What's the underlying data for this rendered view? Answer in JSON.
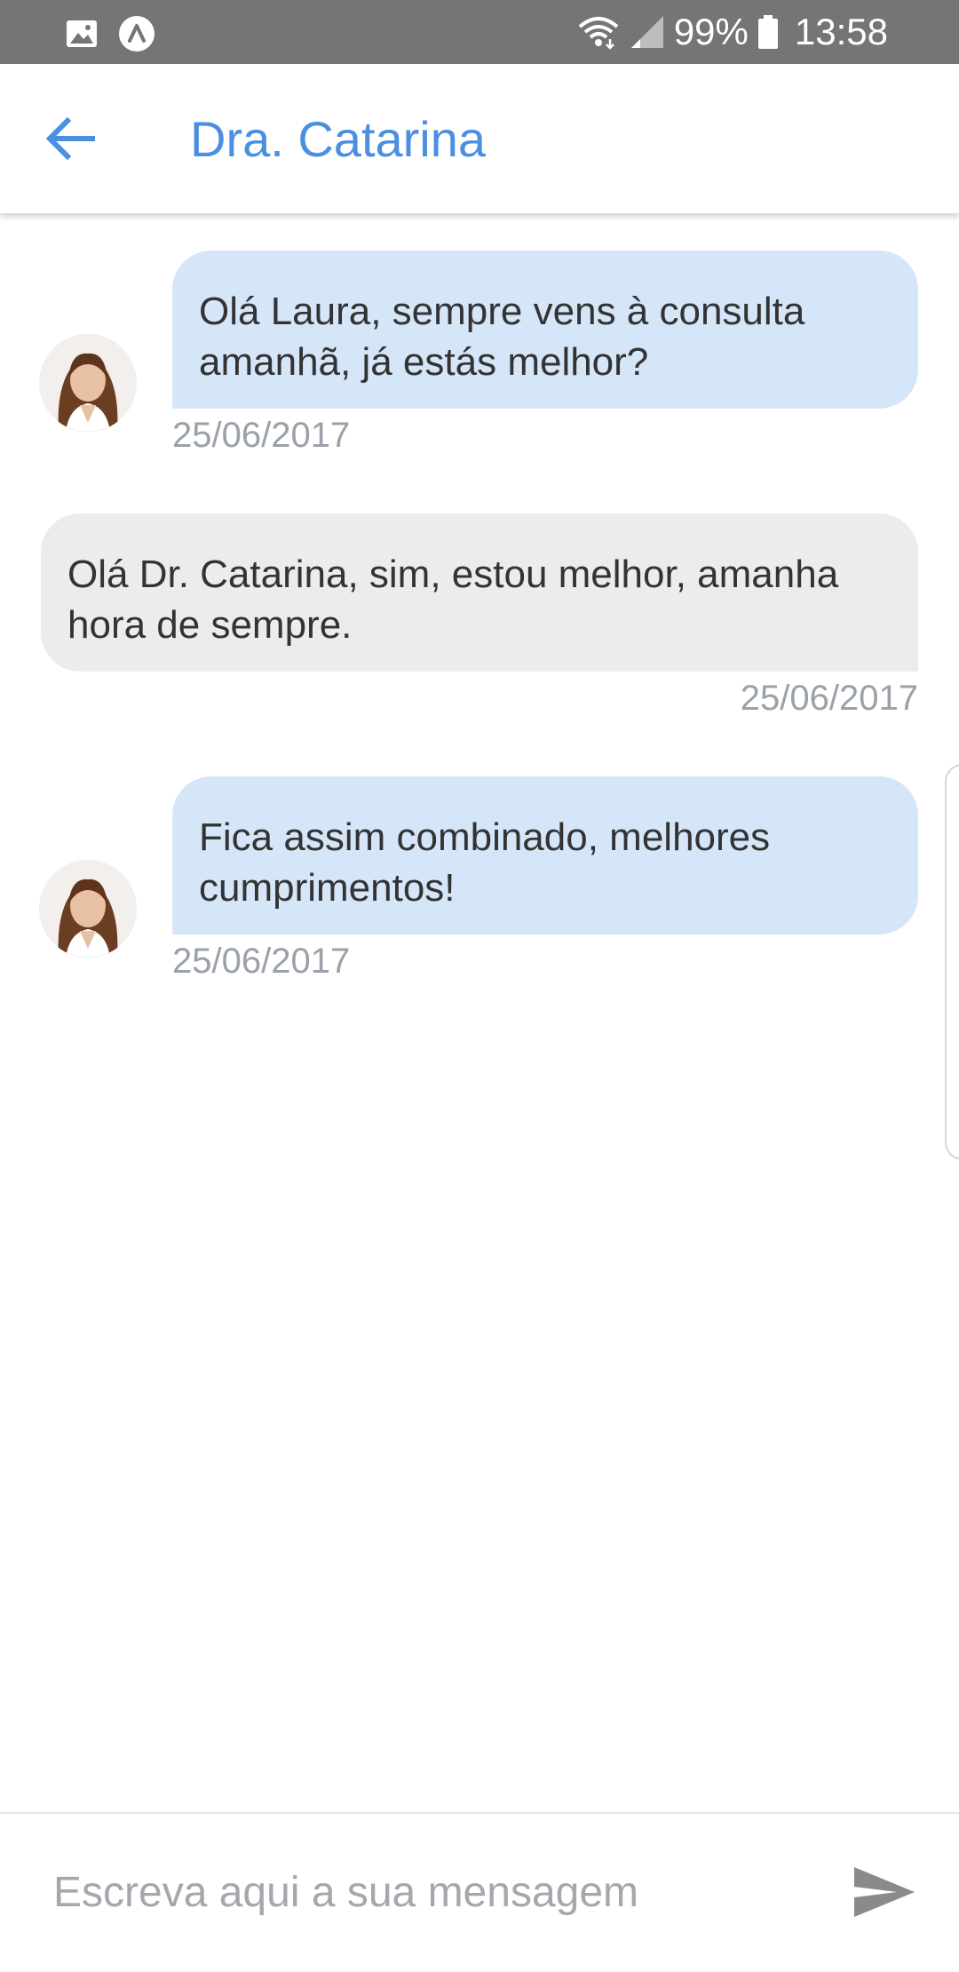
{
  "status_bar": {
    "battery": "99%",
    "time": "13:58",
    "icons": [
      "gallery-icon",
      "app-notification-icon",
      "wifi-icon",
      "signal-icon",
      "battery-icon"
    ]
  },
  "app_bar": {
    "title": "Dra. Catarina",
    "back_icon": "arrow-left-icon",
    "accent_color": "#4a8fe0"
  },
  "messages": [
    {
      "sender": "doctor",
      "text": "Olá Laura, sempre vens à consulta amanhã, já estás melhor?",
      "date": "25/06/2017"
    },
    {
      "sender": "patient",
      "text": "Olá Dr. Catarina, sim, estou melhor, amanha hora de sempre.",
      "date": "25/06/2017"
    },
    {
      "sender": "doctor",
      "text": "Fica assim combinado, melhores cumprimentos!",
      "date": "25/06/2017"
    }
  ],
  "colors": {
    "doctor_bubble": "#d6e6f9",
    "patient_bubble": "#ebeced",
    "status_bar": "#757575"
  },
  "composer": {
    "placeholder": "Escreva aqui a sua mensagem",
    "value": "",
    "send_icon": "send-icon"
  }
}
